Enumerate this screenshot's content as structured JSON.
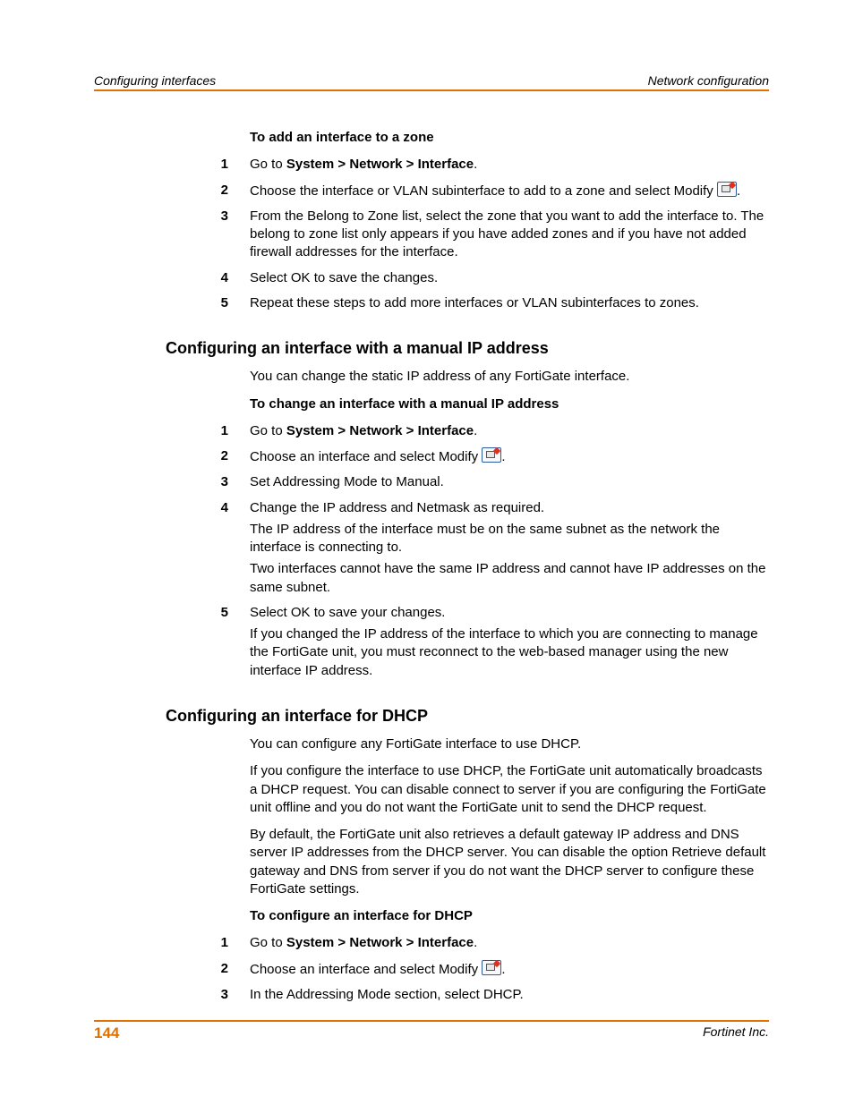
{
  "header": {
    "left": "Configuring interfaces",
    "right": "Network configuration"
  },
  "sections": {
    "s1_title": "To add an interface to a zone",
    "s1_steps": {
      "n1": "1",
      "t1a": "Go to ",
      "t1b": "System > Network > Interface",
      "t1c": ".",
      "n2": "2",
      "t2": "Choose the interface or VLAN subinterface to add to a zone and select Modify ",
      "n3": "3",
      "t3": "From the Belong to Zone list, select the zone that you want to add the interface to. The belong to zone list only appears if you have added zones and if you have not added firewall addresses for the interface.",
      "n4": "4",
      "t4": "Select OK to save the changes.",
      "n5": "5",
      "t5": "Repeat these steps to add more interfaces or VLAN subinterfaces to zones."
    },
    "s2_heading": "Configuring an interface with a manual IP address",
    "s2_intro": "You can change the static IP address of any FortiGate interface.",
    "s2_title": "To change an interface with a manual IP address",
    "s2_steps": {
      "n1": "1",
      "t1a": "Go to ",
      "t1b": "System > Network > Interface",
      "t1c": ".",
      "n2": "2",
      "t2": "Choose an interface and select Modify ",
      "n3": "3",
      "t3": "Set Addressing Mode to Manual.",
      "n4": "4",
      "t4a": "Change the IP address and Netmask as required.",
      "t4b": "The IP address of the interface must be on the same subnet as the network the interface is connecting to.",
      "t4c": "Two interfaces cannot have the same IP address and cannot have IP addresses on the same subnet.",
      "n5": "5",
      "t5a": "Select OK to save your changes.",
      "t5b": "If you changed the IP address of the interface to which you are connecting to manage the FortiGate unit, you must reconnect to the web-based manager using the new interface IP address."
    },
    "s3_heading": "Configuring an interface for DHCP",
    "s3_p1": "You can configure any FortiGate interface to use DHCP.",
    "s3_p2": "If you configure the interface to use DHCP, the FortiGate unit automatically broadcasts a DHCP request. You can disable connect to server if you are configuring the FortiGate unit offline and you do not want the FortiGate unit to send the DHCP request.",
    "s3_p3": "By default, the FortiGate unit also retrieves a default gateway IP address and DNS server IP addresses from the DHCP server. You can disable the option Retrieve default gateway and DNS from server if you do not want the DHCP server to configure these FortiGate settings.",
    "s3_title": "To configure an interface for DHCP",
    "s3_steps": {
      "n1": "1",
      "t1a": "Go to ",
      "t1b": "System > Network > Interface",
      "t1c": ".",
      "n2": "2",
      "t2": "Choose an interface and select Modify ",
      "n3": "3",
      "t3": "In the Addressing Mode section, select DHCP."
    }
  },
  "footer": {
    "page": "144",
    "company": "Fortinet Inc."
  }
}
